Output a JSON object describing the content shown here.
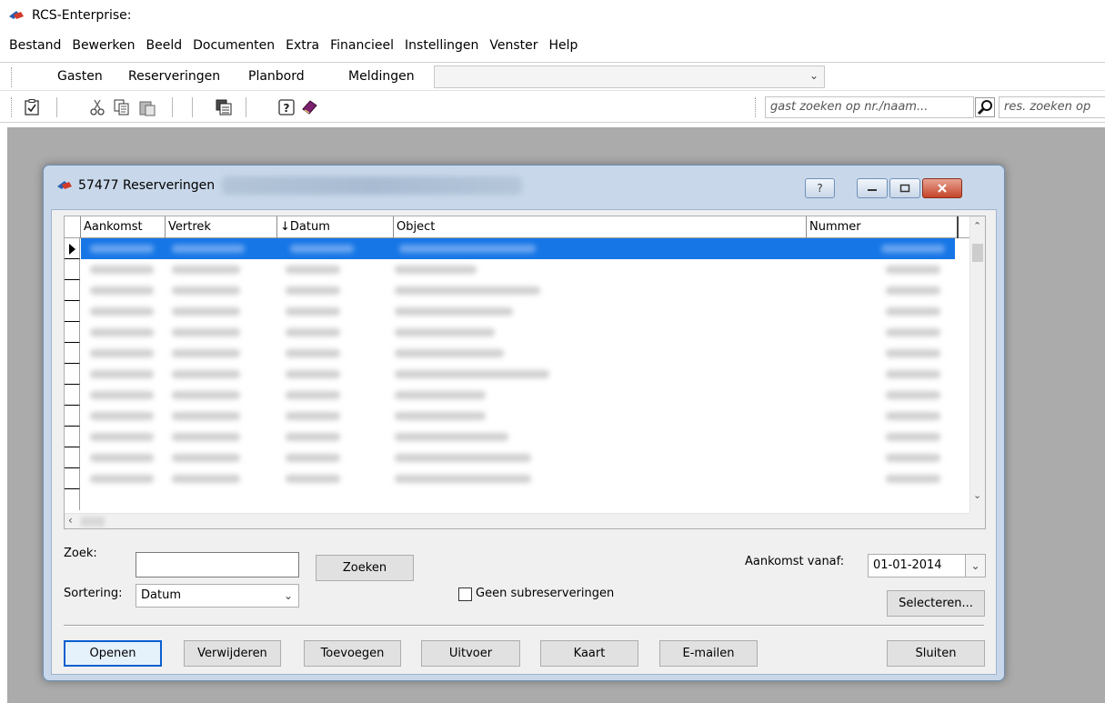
{
  "app": {
    "title": "RCS-Enterprise:"
  },
  "menu": [
    "Bestand",
    "Bewerken",
    "Beeld",
    "Documenten",
    "Extra",
    "Financieel",
    "Instellingen",
    "Venster",
    "Help"
  ],
  "tabs": [
    "Gasten",
    "Reserveringen",
    "Planbord",
    "Meldingen"
  ],
  "toolbar": {
    "guest_search_placeholder": "gast zoeken op nr./naam...",
    "res_search_placeholder": "res. zoeken op"
  },
  "dialog": {
    "title": "57477 Reserveringen",
    "help_label": "?",
    "grid": {
      "columns": [
        "Aankomst",
        "Vertrek",
        "↓Datum",
        "Object",
        "Nummer"
      ]
    },
    "search_label": "Zoek:",
    "search_value": "",
    "search_button": "Zoeken",
    "arrival_label": "Aankomst vanaf:",
    "arrival_value": "01-01-2014",
    "sort_label": "Sortering:",
    "sort_value": "Datum",
    "no_sub_label": "Geen subreserveringen",
    "select_button": "Selecteren...",
    "buttons": {
      "open": "Openen",
      "delete": "Verwijderen",
      "add": "Toevoegen",
      "export": "Uitvoer",
      "map": "Kaart",
      "email": "E-mailen",
      "close": "Sluiten"
    }
  },
  "colors": {
    "selected_row": "#1676e6",
    "workspace": "#ababab",
    "dialog_frame": "#c8d8ea",
    "close_button": "#c4452a"
  }
}
